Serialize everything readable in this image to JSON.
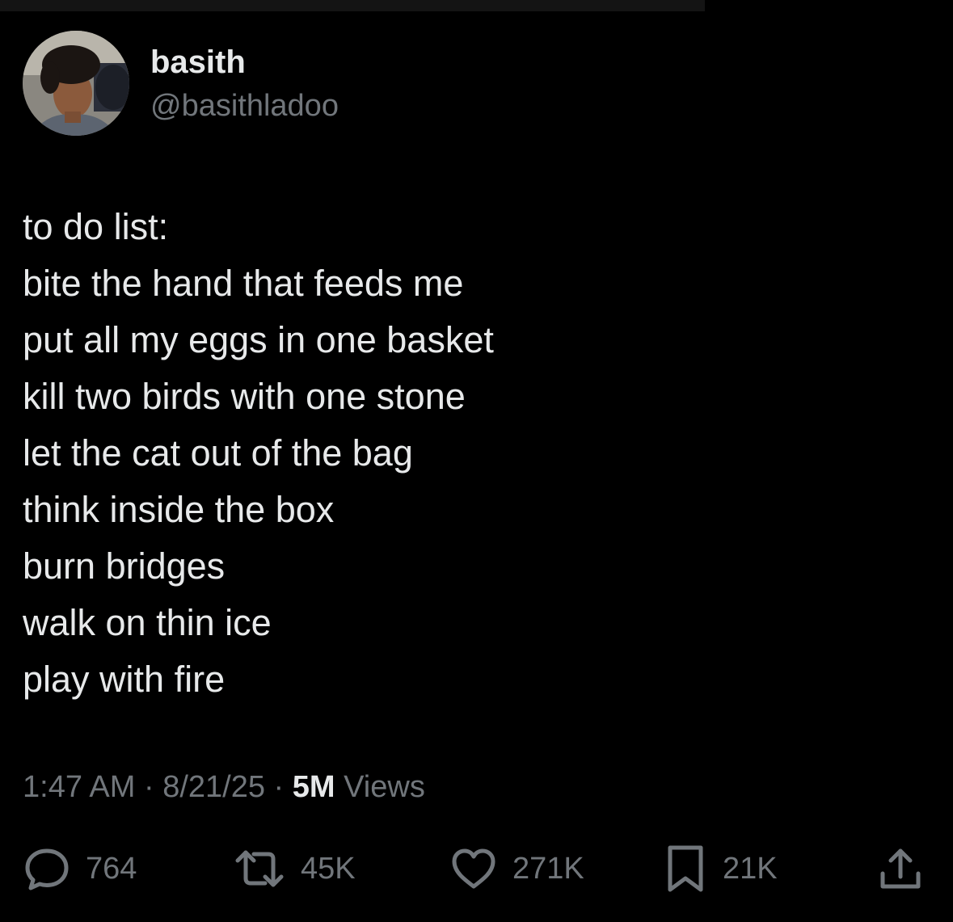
{
  "author": {
    "display_name": "basith",
    "handle": "@basithladoo"
  },
  "tweet": {
    "lines": [
      "to do list:",
      "bite the hand that feeds me",
      "put all my eggs in one basket",
      "kill two birds with one stone",
      "let the cat out of the bag",
      "think inside the box",
      "burn bridges",
      "walk on thin ice",
      "play with fire"
    ]
  },
  "meta": {
    "time": "1:47 AM",
    "sep1": " · ",
    "date": "8/21/25",
    "sep2": " · ",
    "views_count": "5M",
    "views_label": " Views"
  },
  "actions": {
    "replies": "764",
    "reposts": "45K",
    "likes": "271K",
    "bookmarks": "21K"
  },
  "colors": {
    "background": "#000000",
    "primary_text": "#e7e9ea",
    "secondary_text": "#71767b"
  },
  "icons": {
    "reply": "reply-bubble-icon",
    "repost": "repost-arrows-icon",
    "like": "heart-icon",
    "bookmark": "bookmark-icon",
    "share": "share-upload-icon"
  }
}
